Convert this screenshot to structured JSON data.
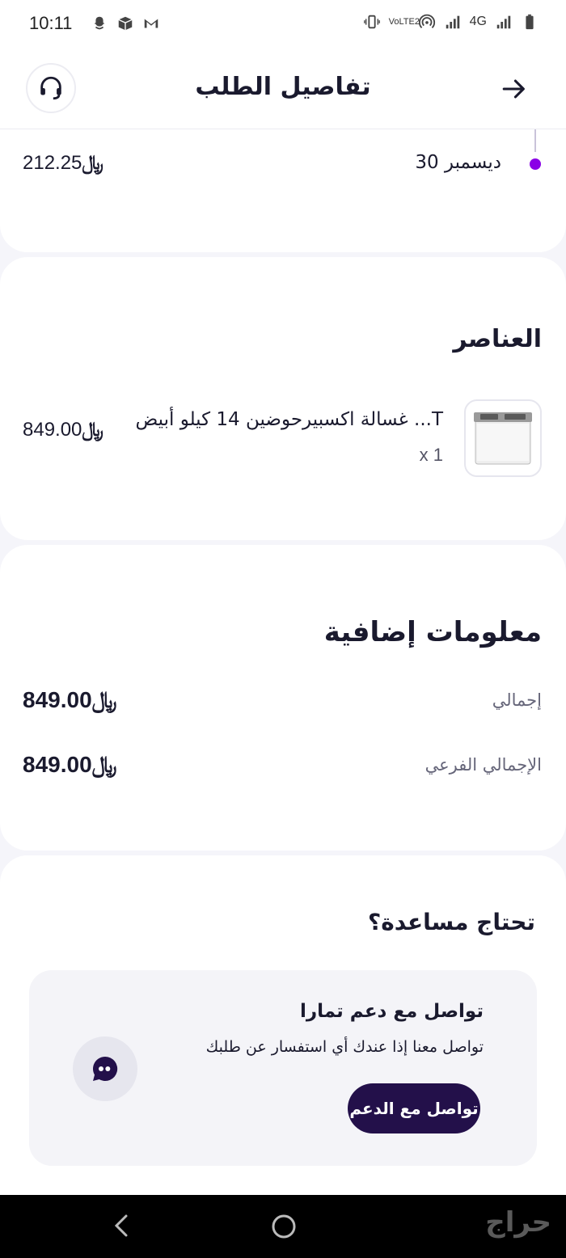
{
  "status_bar": {
    "time": "10:11",
    "network": "4G",
    "volte": "VoLTE2",
    "icons_left": [
      "snapchat-icon",
      "box-icon",
      "gmail-icon"
    ],
    "icons_right": [
      "vibrate-icon",
      "volte-icon",
      "hotspot-icon",
      "signal-icon",
      "signal2-icon",
      "battery-icon"
    ]
  },
  "header": {
    "title": "تفاصيل الطلب",
    "support_icon": "headset-icon",
    "back_icon": "arrow-right-icon"
  },
  "payment_row": {
    "date": "30 ديسمبر",
    "amount": "212.25",
    "currency_symbol": "﷼",
    "dot_color": "#8a00e6"
  },
  "items_section": {
    "title": "العناصر",
    "items": [
      {
        "name": "غسالة اكسبيرحوضين 14 كيلو أبيض ...T",
        "qty": "x 1",
        "price": "849.00",
        "currency_symbol": "﷼"
      }
    ]
  },
  "info_section": {
    "title": "معلومات إضافية",
    "rows": [
      {
        "label": "إجمالي",
        "value": "849.00",
        "currency_symbol": "﷼"
      },
      {
        "label": "الإجمالي الفرعي",
        "value": "849.00",
        "currency_symbol": "﷼"
      }
    ]
  },
  "help_section": {
    "title": "تحتاج مساعدة؟",
    "card_title": "تواصل مع دعم تمارا",
    "card_desc": "تواصل معنا إذا عندك أي استفسار عن طلبك",
    "button_label": "تواصل مع الدعم",
    "button_color": "#23104a"
  },
  "nav_bar": {
    "watermark": "حراج"
  }
}
